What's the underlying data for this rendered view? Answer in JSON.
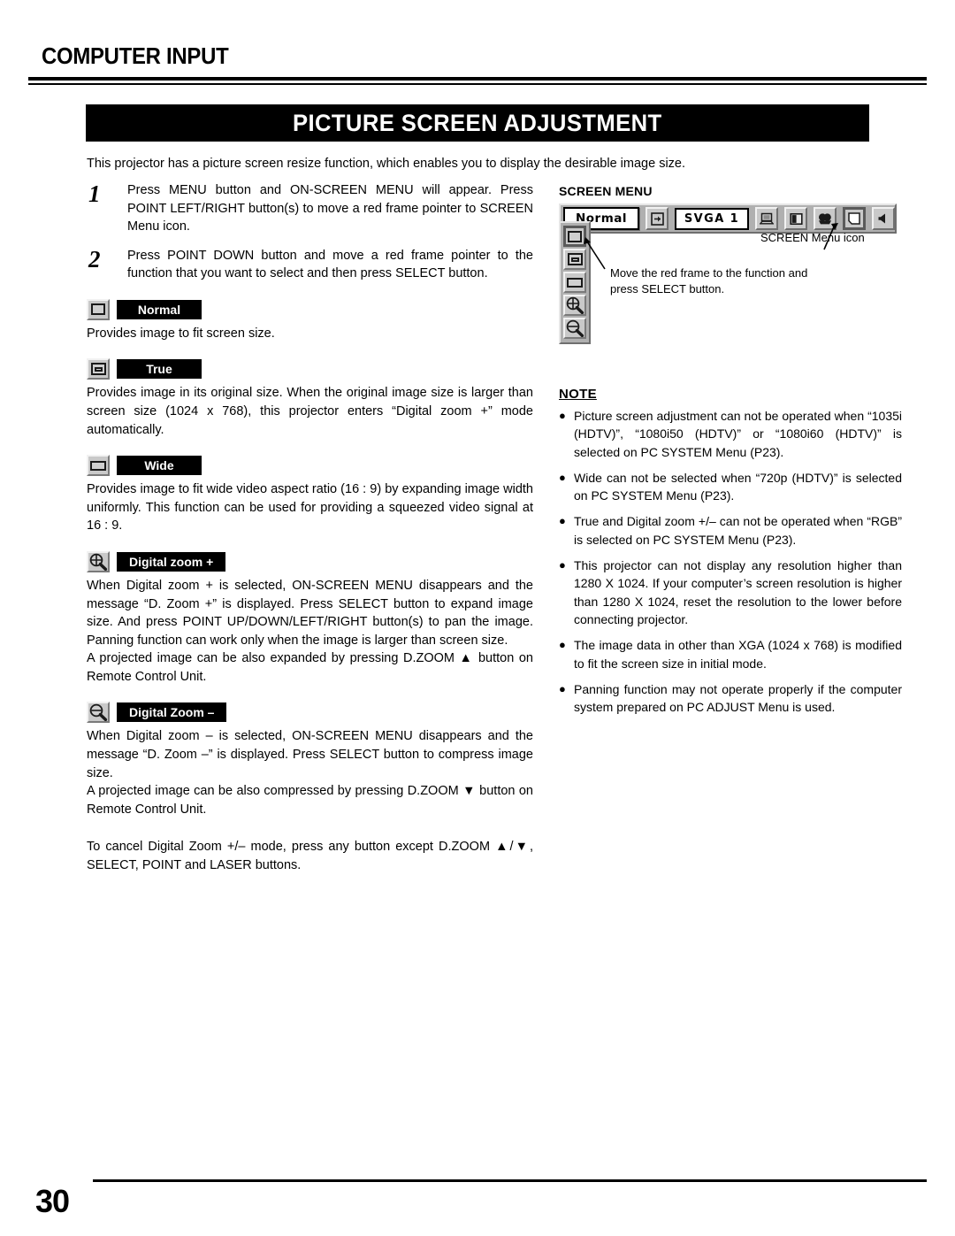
{
  "header": {
    "section_title": "COMPUTER INPUT",
    "banner_title": "PICTURE SCREEN ADJUSTMENT",
    "intro": "This projector has a picture screen resize function, which enables you to display the desirable image size."
  },
  "steps": [
    {
      "number": "1",
      "text": "Press MENU button and ON-SCREEN MENU will appear.  Press POINT LEFT/RIGHT button(s) to move a red frame pointer to SCREEN Menu icon."
    },
    {
      "number": "2",
      "text": "Press POINT DOWN button and move a red frame pointer to the function that you want to select and then press SELECT button."
    }
  ],
  "functions": [
    {
      "icon": "screen-normal-icon",
      "label": "Normal",
      "paragraphs": [
        "Provides image to fit screen size."
      ]
    },
    {
      "icon": "screen-true-icon",
      "label": "True",
      "paragraphs": [
        "Provides image in its original size.  When the original image size is larger than screen size (1024 x 768), this projector enters “Digital zoom +” mode automatically."
      ]
    },
    {
      "icon": "screen-wide-icon",
      "label": "Wide",
      "paragraphs": [
        "Provides image to fit wide video aspect ratio (16 : 9) by expanding image width uniformly.  This function can be used for providing a squeezed video signal at 16 : 9."
      ]
    },
    {
      "icon": "digital-zoom-plus-icon",
      "label": "Digital zoom +",
      "paragraphs": [
        "When Digital zoom + is selected, ON-SCREEN MENU disappears and the message “D. Zoom +” is displayed.  Press SELECT button to expand image size.  And press POINT UP/DOWN/LEFT/RIGHT button(s) to pan the image.  Panning function can work only when the image is larger than screen size.",
        "A projected image can be also expanded by pressing D.ZOOM ▲ button on Remote Control Unit."
      ]
    },
    {
      "icon": "digital-zoom-minus-icon",
      "label": "Digital Zoom –",
      "paragraphs": [
        "When Digital zoom – is selected, ON-SCREEN MENU disappears and the message “D. Zoom –” is displayed.  Press SELECT button to compress image size.",
        "A projected image can be also compressed by pressing D.ZOOM ▼ button on Remote Control Unit."
      ]
    }
  ],
  "tail_paragraph": "To cancel Digital Zoom +/– mode, press any button except D.ZOOM ▲/▼, SELECT, POINT and LASER buttons.",
  "screen_menu": {
    "title": "SCREEN MENU",
    "selected_value": "Normal",
    "system_value": "SVGA 1",
    "bar_icons": [
      "input-source-icon",
      "computer-system-icon",
      "image-adjust-icon",
      "color-adjust-icon",
      "screen-menu-icon",
      "sound-menu-icon"
    ],
    "strip_icons": [
      "screen-normal-icon",
      "screen-true-icon",
      "screen-wide-icon",
      "digital-zoom-plus-icon",
      "digital-zoom-minus-icon"
    ],
    "callout_icon": "SCREEN Menu icon",
    "callout_move": "Move the red frame to the function and\npress SELECT button."
  },
  "note": {
    "title": "NOTE",
    "bullet_glyph": "●",
    "items": [
      "Picture screen adjustment can not be operated when “1035i (HDTV)”, “1080i50 (HDTV)” or “1080i60 (HDTV)” is selected on PC SYSTEM Menu  (P23).",
      "Wide can not be selected when “720p (HDTV)” is selected on PC SYSTEM Menu  (P23).",
      "True and Digital zoom +/– can not be operated when “RGB” is selected on PC SYSTEM Menu (P23).",
      "This projector can not display any resolution higher than 1280 X 1024.  If your computer’s screen resolution is higher than 1280 X 1024, reset the resolution to the lower before connecting projector.",
      "The image data in other than XGA (1024 x 768) is modified to fit the screen size in initial mode.",
      "Panning function may not operate properly if the computer system prepared on PC ADJUST Menu is used."
    ]
  },
  "footer": {
    "page_number": "30"
  },
  "colors": {
    "ink": "#000000",
    "paper": "#ffffff",
    "osd_gray": "#b0b0b0",
    "icon_face": "#c9c9c9"
  }
}
